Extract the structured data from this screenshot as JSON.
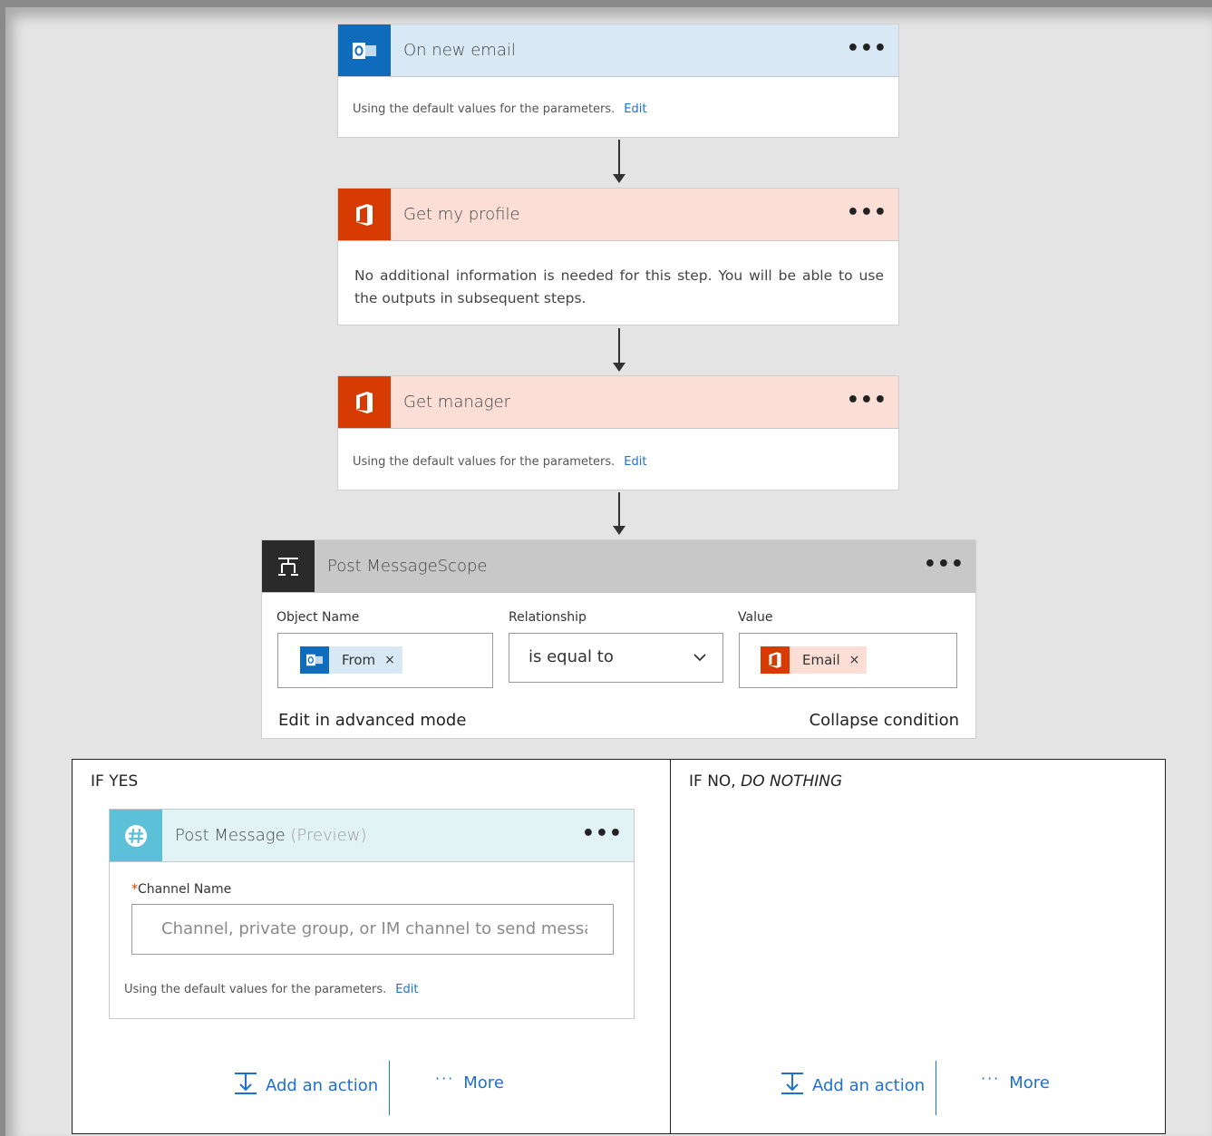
{
  "trigger": {
    "title": "On new email",
    "more": "•••",
    "body_text": "Using the default values for the parameters.",
    "edit": "Edit",
    "accent": "#0f6cbd",
    "head_bg": "#d9e8f5",
    "icon": "outlook-icon"
  },
  "profile_step": {
    "title": "Get my profile",
    "more": "•••",
    "body_text": "No additional information is needed for this step. You will be able to use the outputs in subsequent steps.",
    "accent": "#d83b01",
    "head_bg": "#fbdfd6",
    "icon": "office-icon"
  },
  "manager_step": {
    "title": "Get manager",
    "more": "•••",
    "body_text": "Using the default values for the parameters.",
    "edit": "Edit",
    "accent": "#d83b01",
    "head_bg": "#fbdfd6",
    "icon": "office-icon"
  },
  "condition": {
    "title": "Post MessageScope",
    "more": "•••",
    "icon": "condition-icon",
    "head_bg": "#c8c8c8",
    "object_label": "Object Name",
    "object_token": "From",
    "relationship_label": "Relationship",
    "relationship_value": "is equal to",
    "value_label": "Value",
    "value_token": "Email",
    "remove": "×",
    "advanced": "Edit in advanced mode",
    "collapse": "Collapse condition"
  },
  "if_yes": {
    "title": "IF YES",
    "action": {
      "title": "Post Message",
      "preview": "(Preview)",
      "more": "•••",
      "icon": "slack-icon",
      "head_bg": "#e2f3f6",
      "accent": "#5bc0d8",
      "required": "*",
      "channel_label": "Channel Name",
      "channel_placeholder": "Channel, private group, or IM channel to send messag",
      "body_text": "Using the default values for the parameters.",
      "edit": "Edit"
    },
    "add_action": "Add an action",
    "more": "More"
  },
  "if_no": {
    "title_prefix": "IF NO,",
    "title_italic": "DO NOTHING",
    "add_action": "Add an action",
    "more": "More"
  }
}
